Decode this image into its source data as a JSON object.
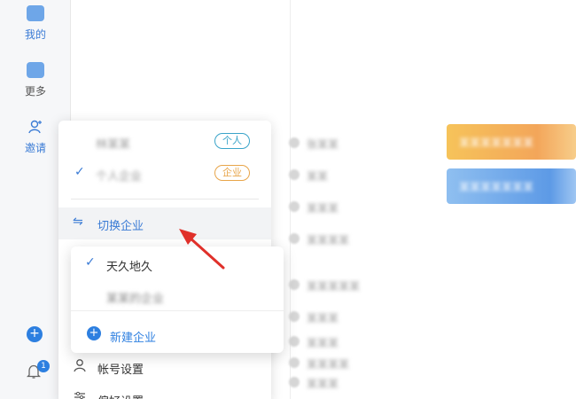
{
  "rail": {
    "items": [
      {
        "label": "我的"
      },
      {
        "label": "更多"
      },
      {
        "label": "邀请"
      }
    ],
    "bell_badge": "1",
    "add_symbol": "+"
  },
  "account_menu": {
    "accounts": [
      {
        "name": "林某某",
        "tag": "个人",
        "selected": false
      },
      {
        "name": "个人企业",
        "tag": "企业",
        "selected": true
      }
    ],
    "switch_label": "切换企业",
    "switch_icon": "swap-icon",
    "items": [
      {
        "label": "帐号设置",
        "icon": "user-icon"
      },
      {
        "label": "偏好设置",
        "icon": "settings-icon"
      }
    ]
  },
  "switch_submenu": {
    "items": [
      {
        "label": "天久地久",
        "selected": true
      },
      {
        "label": "某某的企业",
        "selected": false
      }
    ],
    "new_label": "新建企业",
    "new_symbol": "+"
  },
  "contacts": {
    "rows": [
      {
        "text": "张某某"
      },
      {
        "text": "某某"
      },
      {
        "text": "某某某"
      },
      {
        "text": "某某某某"
      },
      {
        "text": "某某某某某"
      },
      {
        "text": "某某某"
      },
      {
        "text": "某某某"
      },
      {
        "text": "某某某某"
      },
      {
        "text": "某某某"
      }
    ]
  },
  "cards": [
    {
      "text": "某某某某某某某"
    },
    {
      "text": "某某某某某某某"
    }
  ],
  "colors": {
    "accent": "#2d7fe0",
    "tag_personal": "#3aa4c9",
    "tag_company": "#e8a54a",
    "arrow": "#e0302a"
  },
  "check_symbol": "✓"
}
